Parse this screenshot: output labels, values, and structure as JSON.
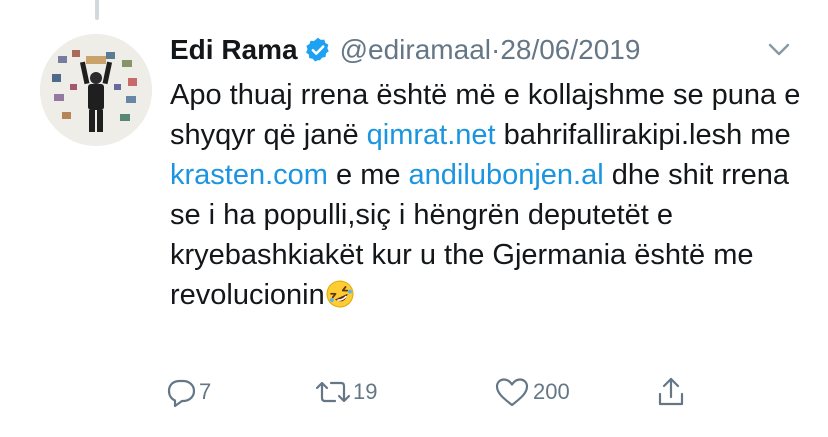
{
  "tweet": {
    "author_name": "Edi Rama",
    "handle": "@ediramaal",
    "separator": " · ",
    "date": "28/06/2019",
    "text": {
      "t1": "Apo thuaj rrena është më e kollajshme se puna e shyqyr që janë ",
      "link1": "qimrat.net",
      "t2": " bahrifallirakipi.lesh me ",
      "link2": "krasten.com",
      "t3": " e me ",
      "link3": "andilubonjen.al",
      "t4": " dhe shit rrena se i ha populli,siç i hëngrën deputetët e kryebashkiakët kur u the Gjermania është me revolucionin"
    },
    "emoji": "rolling-on-the-floor-laughing",
    "counts": {
      "replies": "7",
      "retweets": "19",
      "likes": "200"
    }
  },
  "colors": {
    "link": "#1b95e0",
    "muted": "#657786",
    "verified": "#1da1f2"
  }
}
